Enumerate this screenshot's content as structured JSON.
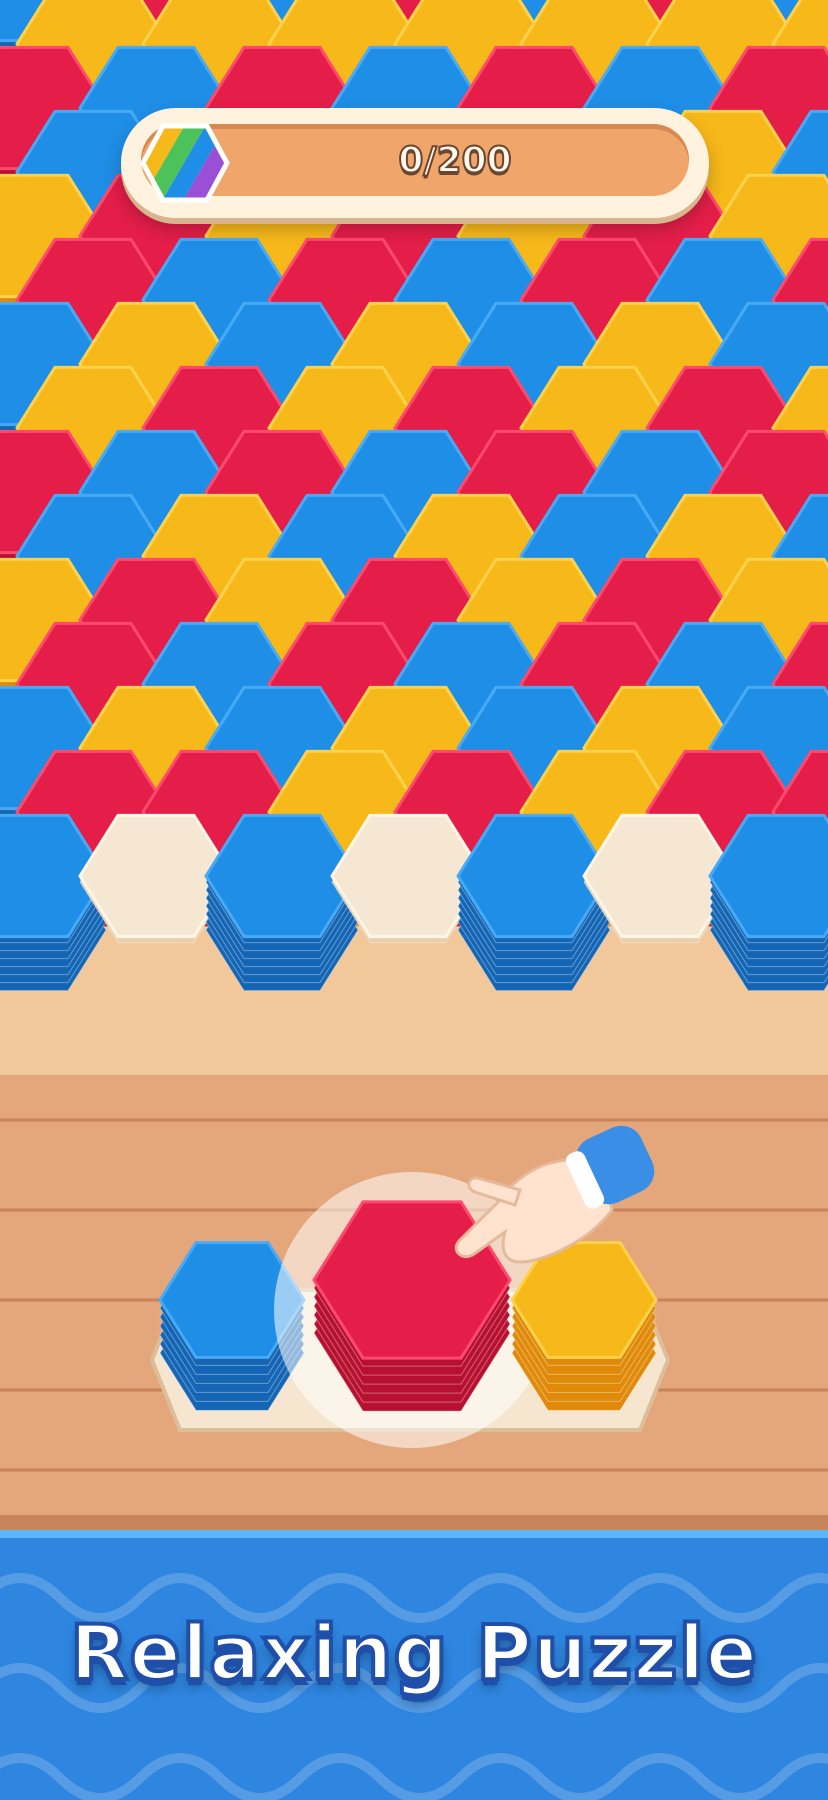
{
  "progress": {
    "text": "0/200",
    "current": 0,
    "target": 200
  },
  "banner": {
    "title": "Relaxing Puzzle"
  },
  "colors": {
    "red": "#e41e48",
    "blue": "#1f8ee6",
    "yellow": "#f7b81a",
    "empty_slot": "#f6e7d2",
    "wood": "#e4a67b",
    "banner": "#2f86e0"
  },
  "board": {
    "rows": [
      [
        "blue",
        "red",
        "blue",
        "red",
        "blue",
        "red",
        "blue"
      ],
      [
        "yellow",
        "yellow",
        "yellow",
        "yellow",
        "yellow",
        "yellow",
        "yellow"
      ],
      [
        "red",
        "blue",
        "red",
        "blue",
        "red",
        "blue",
        "red"
      ],
      [
        "blue",
        "yellow",
        "blue",
        "yellow",
        "blue",
        "yellow",
        "blue"
      ],
      [
        "yellow",
        "red",
        "yellow",
        "red",
        "yellow",
        "red",
        "yellow"
      ],
      [
        "red",
        "blue",
        "red",
        "blue",
        "red",
        "blue",
        "red"
      ],
      [
        "blue",
        "yellow",
        "blue",
        "yellow",
        "blue",
        "yellow",
        "blue"
      ],
      [
        "yellow",
        "red",
        "yellow",
        "red",
        "yellow",
        "red",
        "yellow"
      ],
      [
        "red",
        "blue",
        "red",
        "blue",
        "red",
        "blue",
        "red"
      ],
      [
        "blue",
        "yellow",
        "blue",
        "yellow",
        "blue",
        "yellow",
        "blue"
      ],
      [
        "yellow",
        "red",
        "yellow",
        "red",
        "yellow",
        "red",
        "yellow"
      ],
      [
        "red",
        "blue",
        "red",
        "blue",
        "red",
        "blue",
        "red"
      ],
      [
        "blue",
        "yellow",
        "blue",
        "yellow",
        "blue",
        "yellow",
        "blue"
      ],
      [
        "red",
        "red",
        "yellow",
        "red",
        "yellow",
        "red",
        "red"
      ],
      [
        "blue",
        "empty",
        "blue",
        "empty",
        "blue",
        "empty",
        "blue"
      ]
    ]
  },
  "tray": [
    {
      "color": "blue",
      "stack": 6,
      "selected": false
    },
    {
      "color": "red",
      "stack": 6,
      "selected": true
    },
    {
      "color": "yellow",
      "stack": 6,
      "selected": false
    }
  ],
  "hint": {
    "icon": "pointing-hand-icon"
  }
}
